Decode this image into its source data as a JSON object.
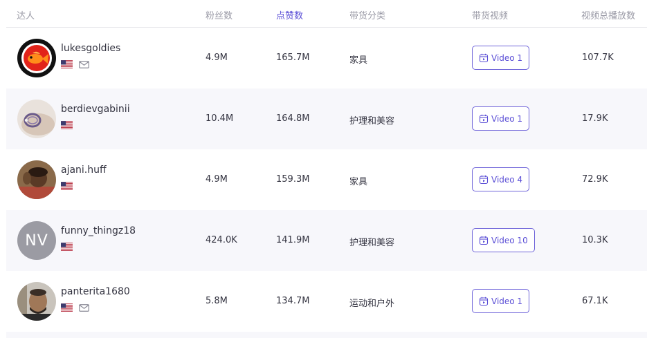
{
  "columns": {
    "creator": "达人",
    "followers": "粉丝数",
    "likes": "点赞数",
    "category": "带货分类",
    "video": "带货视频",
    "total_views": "视频总播放数"
  },
  "sort_column_color": "#5b4fd6",
  "rows": [
    {
      "name": "lukesgoldies",
      "avatar": "goldfish-logo-avatar",
      "flag": "us-flag-icon",
      "email_icon": true,
      "followers": "4.9M",
      "likes": "165.7M",
      "category": "家具",
      "video_label": "Video 1",
      "views": "107.7K"
    },
    {
      "name": "berdievgabinii",
      "avatar": "bracelet-photo-avatar",
      "flag": "us-flag-icon",
      "email_icon": false,
      "followers": "10.4M",
      "likes": "164.8M",
      "category": "护理和美容",
      "video_label": "Video 1",
      "views": "17.9K"
    },
    {
      "name": "ajani.huff",
      "avatar": "child-photo-avatar",
      "flag": "us-flag-icon",
      "email_icon": false,
      "followers": "4.9M",
      "likes": "159.3M",
      "category": "家具",
      "video_label": "Video 4",
      "views": "72.9K"
    },
    {
      "name": "funny_thingz18",
      "avatar_initials": "NV",
      "flag": "us-flag-icon",
      "email_icon": false,
      "followers": "424.0K",
      "likes": "141.9M",
      "category": "护理和美容",
      "video_label": "Video 10",
      "views": "10.3K"
    },
    {
      "name": "panterita1680",
      "avatar": "man-photo-avatar",
      "flag": "us-flag-icon",
      "email_icon": true,
      "followers": "5.8M",
      "likes": "134.7M",
      "category": "运动和户外",
      "video_label": "Video 1",
      "views": "67.1K"
    }
  ]
}
